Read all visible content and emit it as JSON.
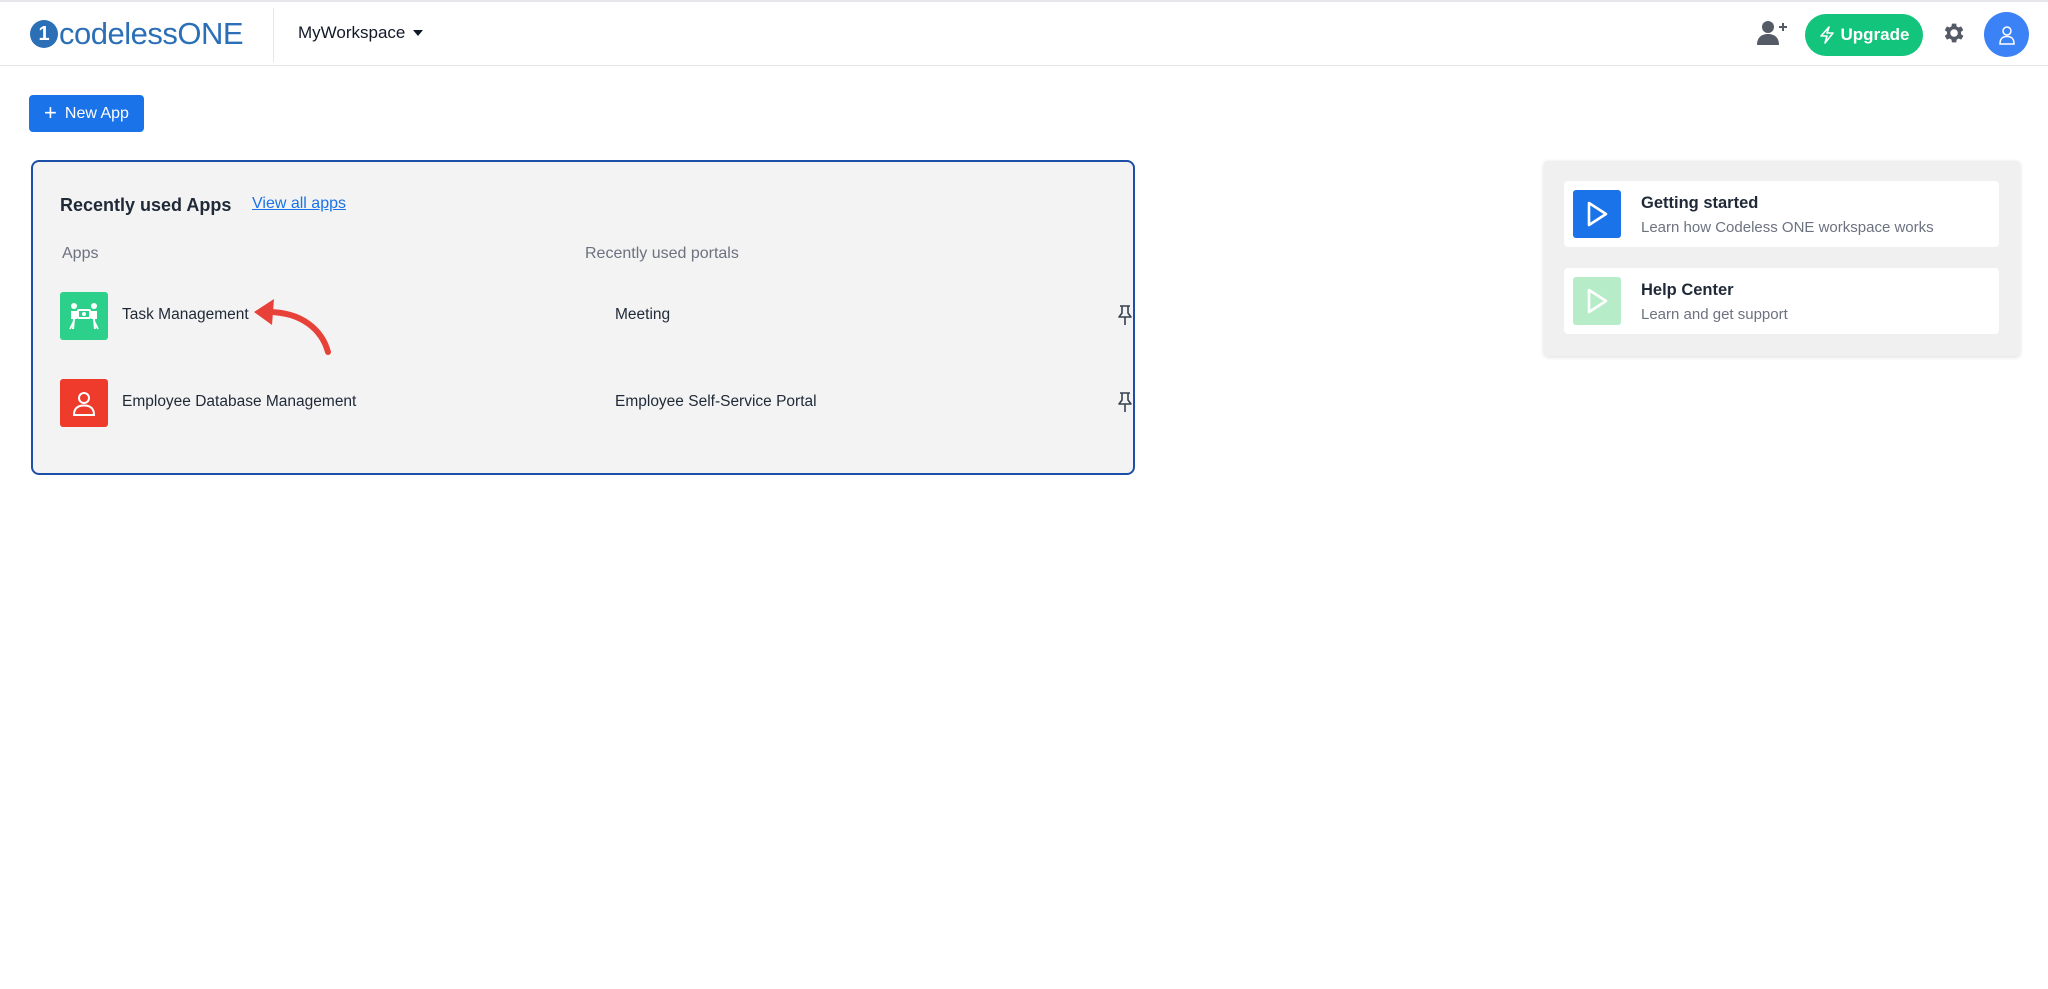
{
  "header": {
    "logo_mark": "1",
    "logo_text_a": "codeless",
    "logo_text_b": "ONE",
    "workspace_label": "MyWorkspace",
    "upgrade_label": "Upgrade",
    "icons": [
      "add-user-icon",
      "lightning-icon",
      "gear-icon",
      "user-icon"
    ]
  },
  "actions": {
    "new_app_plus": "+",
    "new_app_label": "New App"
  },
  "recent": {
    "title": "Recently used Apps",
    "view_all_label": "View all apps",
    "col_apps": "Apps",
    "col_portals": "Recently used portals",
    "rows": [
      {
        "app": "Task Management",
        "portal": "Meeting",
        "icon": "people-icon",
        "icon_color": "#2dd08a"
      },
      {
        "app": "Employee Database Management",
        "portal": "Employee Self-Service Portal",
        "icon": "user-icon",
        "icon_color": "#ef3b2c"
      }
    ]
  },
  "help": {
    "items": [
      {
        "title": "Getting started",
        "subtitle": "Learn how Codeless ONE workspace works",
        "icon": "play-icon",
        "icon_color": "#1a73e8"
      },
      {
        "title": "Help Center",
        "subtitle": "Learn and get support",
        "icon": "play-icon",
        "icon_color": "#b7ecc8"
      }
    ]
  },
  "colors": {
    "brand": "#2b6fb7",
    "primary": "#1a73e8",
    "upgrade": "#12c47c",
    "card_border": "#1e4fa8",
    "annotation": "#e8413a"
  }
}
